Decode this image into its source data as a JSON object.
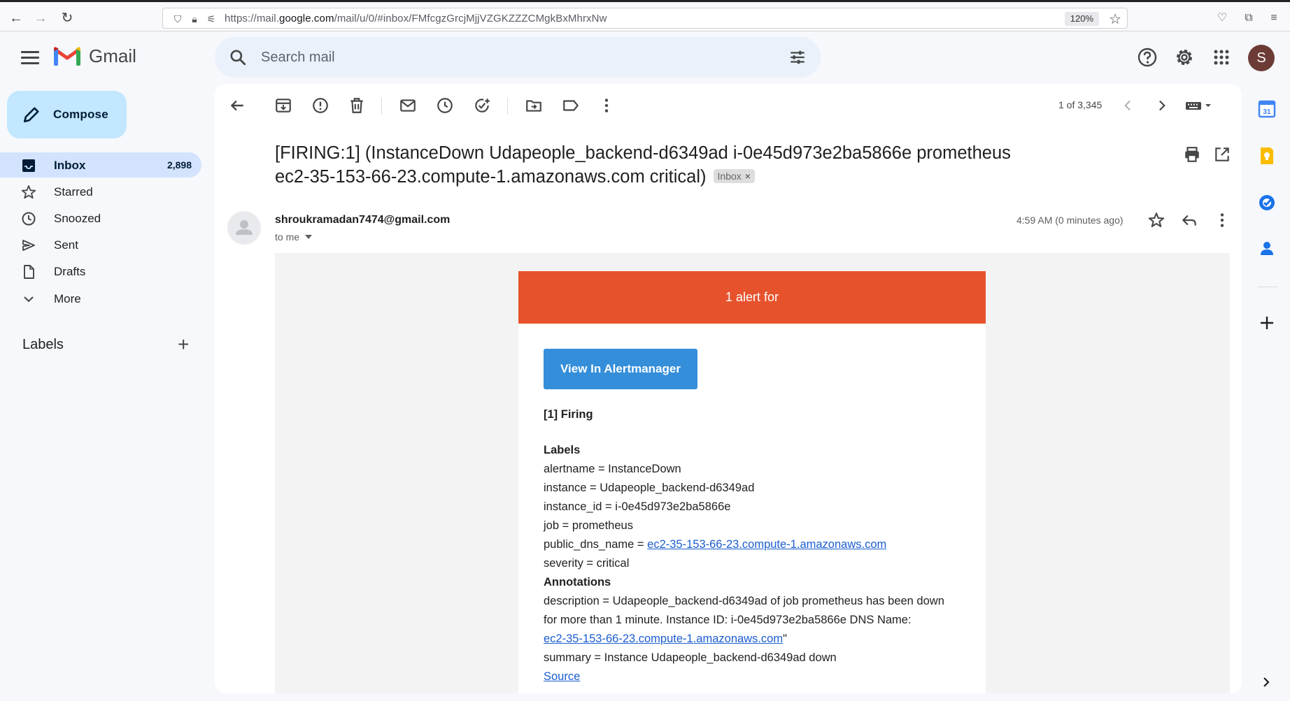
{
  "browser": {
    "url_prefix": "https://mail.",
    "url_host": "google.com",
    "url_path": "/mail/u/0/#inbox/FMfcgzGrcjMjjVZGKZZZCMgkBxMhrxNw",
    "zoom": "120%"
  },
  "header": {
    "app_name": "Gmail",
    "search_placeholder": "Search mail",
    "avatar_letter": "S"
  },
  "sidebar": {
    "compose_label": "Compose",
    "items": [
      {
        "label": "Inbox",
        "count": "2,898",
        "icon": "inbox-icon"
      },
      {
        "label": "Starred",
        "icon": "star-icon"
      },
      {
        "label": "Snoozed",
        "icon": "clock-icon"
      },
      {
        "label": "Sent",
        "icon": "send-icon"
      },
      {
        "label": "Drafts",
        "icon": "draft-icon"
      },
      {
        "label": "More",
        "icon": "chevron-down-icon"
      }
    ],
    "labels_heading": "Labels",
    "labels_add": "+"
  },
  "toolbar": {
    "pager": "1 of 3,345"
  },
  "message": {
    "subject": "[FIRING:1] (InstanceDown Udapeople_backend-d6349ad i-0e45d973e2ba5866e prometheus ec2-35-153-66-23.compute-1.amazonaws.com critical)",
    "label_chip": "Inbox",
    "label_chip_close": "×",
    "sender": "shroukramadan7474@gmail.com",
    "to": "to me",
    "time": "4:59 AM (0 minutes ago)"
  },
  "alert": {
    "header": "1 alert for",
    "button": "View In Alertmanager",
    "firing": "[1] Firing",
    "labels_heading": "Labels",
    "labels": {
      "alertname": "alertname = InstanceDown",
      "instance": "instance = Udapeople_backend-d6349ad",
      "instance_id": "instance_id = i-0e45d973e2ba5866e",
      "job": "job = prometheus",
      "public_dns_prefix": "public_dns_name = ",
      "public_dns_link": "ec2-35-153-66-23.compute-1.amazonaws.com",
      "severity": "severity = critical"
    },
    "annotations_heading": "Annotations",
    "description_line1": "description = Udapeople_backend-d6349ad of job prometheus has been down",
    "description_line2": "for more than 1 minute. Instance ID: i-0e45d973e2ba5866e DNS Name:",
    "description_link": "ec2-35-153-66-23.compute-1.amazonaws.com",
    "description_suffix": "\"",
    "summary": "summary = Instance Udapeople_backend-d6349ad down",
    "source_link": "Source"
  },
  "colors": {
    "alert_header": "#e6522c",
    "alert_button": "#348eda",
    "compose_bg": "#c2e7ff",
    "active_nav": "#d3e3fd"
  }
}
